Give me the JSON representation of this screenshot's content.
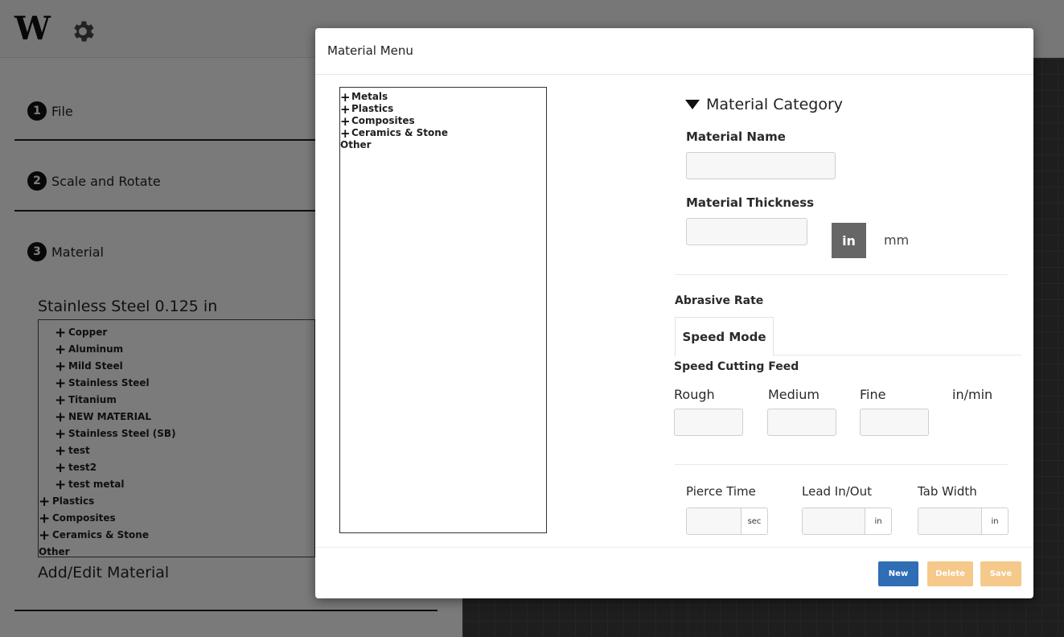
{
  "app": {
    "logo": "W",
    "steps": [
      {
        "number": "1",
        "label": "File"
      },
      {
        "number": "2",
        "label": "Scale and Rotate"
      },
      {
        "number": "3",
        "label": "Material"
      }
    ],
    "current_material": "Stainless Steel 0.125 in",
    "tree": {
      "metals": [
        "Copper",
        "Aluminum",
        "Mild Steel",
        "Stainless Steel",
        "Titanium",
        "NEW MATERIAL",
        "Stainless Steel (SB)",
        "test",
        "test2",
        "test metal"
      ],
      "categories": [
        "Plastics",
        "Composites",
        "Ceramics & Stone"
      ],
      "other": "Other"
    },
    "add_edit_label": "Add/Edit Material"
  },
  "modal": {
    "title": "Material Menu",
    "tree": {
      "categories": [
        "Metals",
        "Plastics",
        "Composites",
        "Ceramics & Stone"
      ],
      "other": "Other"
    },
    "category_header": "Material Category",
    "material_name_label": "Material Name",
    "material_name_value": "",
    "thickness_label": "Material Thickness",
    "thickness_value": "",
    "unit_selected": "in",
    "unit_other": "mm",
    "abrasive_rate_label": "Abrasive Rate",
    "speed_mode_tab": "Speed Mode",
    "speed_cutting_feed_label": "Speed Cutting Feed",
    "feed_columns": [
      "Rough",
      "Medium",
      "Fine"
    ],
    "feed_unit": "in/min",
    "pierce_time_label": "Pierce Time",
    "pierce_time_unit": "sec",
    "lead_label": "Lead In/Out",
    "lead_unit": "in",
    "tab_width_label": "Tab Width",
    "tab_width_unit": "in",
    "buttons": {
      "new": "New",
      "delete": "Delete",
      "save": "Save"
    }
  },
  "colors": {
    "new_button": "#2f6db5",
    "disabled_button": "#f5c98a",
    "unit_selected_bg": "#666666"
  }
}
